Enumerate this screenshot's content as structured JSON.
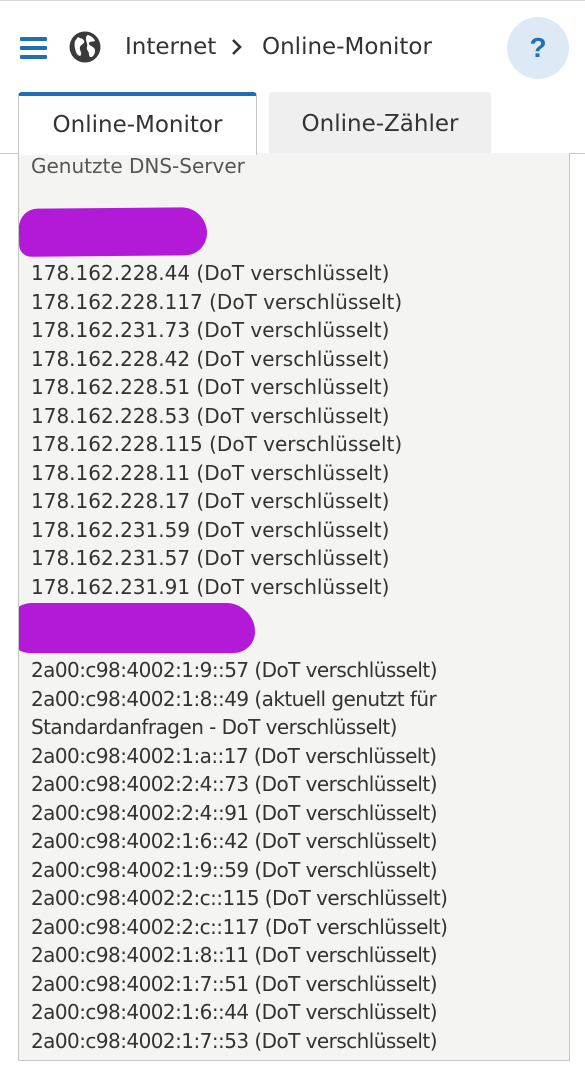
{
  "header": {
    "menu_icon": "hamburger-menu-icon",
    "section_icon": "globe-icon",
    "breadcrumb_parent": "Internet",
    "breadcrumb_separator_icon": "chevron-right-icon",
    "breadcrumb_current": "Online-Monitor",
    "help_label": "?"
  },
  "tabs": [
    {
      "label": "Online-Monitor",
      "active": true
    },
    {
      "label": "Online-Zähler",
      "active": false
    }
  ],
  "panel": {
    "title": "Genutzte DNS-Server",
    "ipv4_servers": [
      "178.162.228.44 (DoT verschlüsselt)",
      "178.162.228.117 (DoT verschlüsselt)",
      "178.162.231.73 (DoT verschlüsselt)",
      "178.162.228.42 (DoT verschlüsselt)",
      "178.162.228.51 (DoT verschlüsselt)",
      "178.162.228.53 (DoT verschlüsselt)",
      "178.162.228.115 (DoT verschlüsselt)",
      "178.162.228.11 (DoT verschlüsselt)",
      "178.162.228.17 (DoT verschlüsselt)",
      "178.162.231.59 (DoT verschlüsselt)",
      "178.162.231.57 (DoT verschlüsselt)",
      "178.162.231.91 (DoT verschlüsselt)"
    ],
    "ipv6_servers": [
      "2a00:c98:4002:1:9::57 (DoT verschlüsselt)",
      "2a00:c98:4002:1:8::49 (aktuell genutzt für",
      "Standardanfragen - DoT verschlüsselt)",
      "2a00:c98:4002:1:a::17 (DoT verschlüsselt)",
      "2a00:c98:4002:2:4::73 (DoT verschlüsselt)",
      "2a00:c98:4002:2:4::91 (DoT verschlüsselt)",
      "2a00:c98:4002:1:6::42 (DoT verschlüsselt)",
      "2a00:c98:4002:1:9::59 (DoT verschlüsselt)",
      "2a00:c98:4002:2:c::115 (DoT verschlüsselt)",
      "2a00:c98:4002:2:c::117 (DoT verschlüsselt)",
      "2a00:c98:4002:1:8::11 (DoT verschlüsselt)",
      "2a00:c98:4002:1:7::51 (DoT verschlüsselt)",
      "2a00:c98:4002:1:6::44 (DoT verschlüsselt)",
      "2a00:c98:4002:1:7::53 (DoT verschlüsselt)"
    ]
  },
  "colors": {
    "accent": "#1f6fb2",
    "redaction": "#b31ad8",
    "panel_bg": "#f4f4f2"
  }
}
